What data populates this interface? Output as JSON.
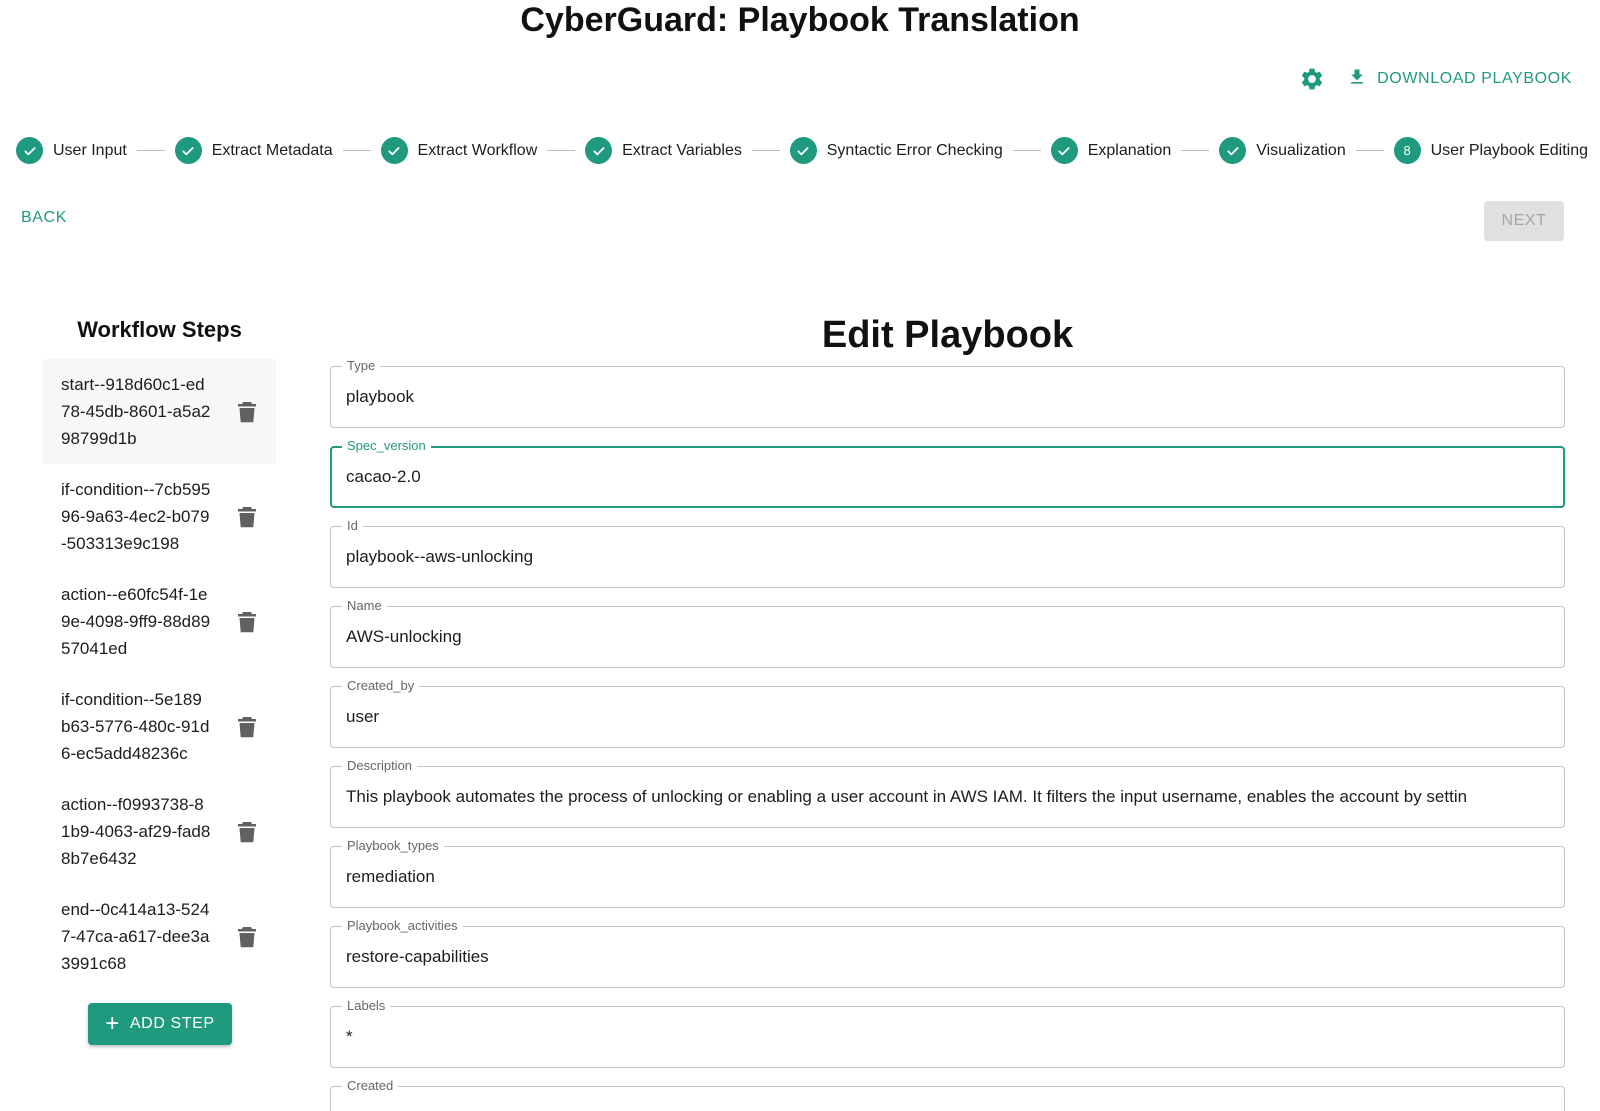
{
  "app": {
    "title": "CyberGuard: Playbook Translation"
  },
  "actions": {
    "settings_icon": "gear-icon",
    "download_label": "DOWNLOAD PLAYBOOK",
    "download_icon": "download-icon"
  },
  "stepper": {
    "steps": [
      {
        "label": "User Input",
        "status": "completed"
      },
      {
        "label": "Extract Metadata",
        "status": "completed"
      },
      {
        "label": "Extract Workflow",
        "status": "completed"
      },
      {
        "label": "Extract Variables",
        "status": "completed"
      },
      {
        "label": "Syntactic Error Checking",
        "status": "completed"
      },
      {
        "label": "Explanation",
        "status": "completed"
      },
      {
        "label": "Visualization",
        "status": "completed"
      },
      {
        "label": "User Playbook Editing",
        "status": "active",
        "number": "8"
      }
    ]
  },
  "nav": {
    "back_label": "BACK",
    "next_label": "NEXT"
  },
  "sidebar": {
    "title": "Workflow Steps",
    "items": [
      {
        "id": "start--918d60c1-ed78-45db-8601-a5a298799d1b",
        "selected": true
      },
      {
        "id": "if-condition--7cb59596-9a63-4ec2-b079-503313e9c198",
        "selected": false
      },
      {
        "id": "action--e60fc54f-1e9e-4098-9ff9-88d8957041ed",
        "selected": false
      },
      {
        "id": "if-condition--5e189b63-5776-480c-91d6-ec5add48236c",
        "selected": false
      },
      {
        "id": "action--f0993738-81b9-4063-af29-fad88b7e6432",
        "selected": false
      },
      {
        "id": "end--0c414a13-5247-47ca-a617-dee3a3991c68",
        "selected": false
      }
    ],
    "add_step_label": "ADD STEP"
  },
  "editor": {
    "title": "Edit Playbook",
    "fields": [
      {
        "label": "Type",
        "value": "playbook"
      },
      {
        "label": "Spec_version",
        "value": "cacao-2.0",
        "focused": true
      },
      {
        "label": "Id",
        "value": "playbook--aws-unlocking"
      },
      {
        "label": "Name",
        "value": "AWS-unlocking"
      },
      {
        "label": "Created_by",
        "value": "user"
      },
      {
        "label": "Description",
        "value": "This playbook automates the process of unlocking or enabling a user account in AWS IAM. It filters the input username, enables the account by settin"
      },
      {
        "label": "Playbook_types",
        "value": "remediation"
      },
      {
        "label": "Playbook_activities",
        "value": "restore-capabilities"
      },
      {
        "label": "Labels",
        "value": "*"
      },
      {
        "label": "Created",
        "value": ""
      }
    ]
  },
  "colors": {
    "accent": "#1f9a7e",
    "disabled_bg": "#e0e0e0",
    "disabled_text": "#a6a6a6"
  }
}
